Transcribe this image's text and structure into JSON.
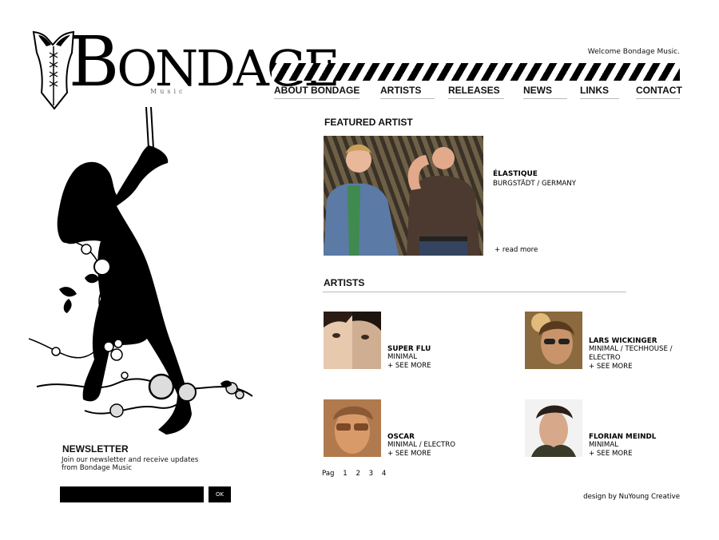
{
  "logo": {
    "text_b": "B",
    "text_rest": "ONDAGE",
    "sub": "Music"
  },
  "header": {
    "welcome": "Welcome Bondage Music."
  },
  "nav": {
    "items": [
      {
        "label": "ABOUT BONDAGE"
      },
      {
        "label": "ARTISTS"
      },
      {
        "label": "RELEASES"
      },
      {
        "label": "NEWS"
      },
      {
        "label": "LINKS"
      },
      {
        "label": "CONTACT"
      }
    ]
  },
  "featured": {
    "title": "FEATURED ARTIST",
    "name": "ÉLASTIQUE",
    "location": "BURGSTÄDT / GERMANY",
    "more": "+ read more"
  },
  "artists": {
    "title": "ARTISTS",
    "items": [
      {
        "name": "SUPER FLU",
        "genre": "MINIMAL",
        "more": "+ SEE MORE"
      },
      {
        "name": "LARS WICKINGER",
        "genre": "MINIMAL / TECHHOUSE / ELECTRO",
        "more": "+ SEE MORE"
      },
      {
        "name": "OSCAR",
        "genre": "MINIMAL / ELECTRO",
        "more": "+ SEE MORE"
      },
      {
        "name": "FLORIAN MEINDL",
        "genre": "MINIMAL",
        "more": "+ SEE MORE"
      }
    ]
  },
  "pager": {
    "label": "Pag",
    "pages": [
      "1",
      "2",
      "3",
      "4"
    ]
  },
  "newsletter": {
    "title": "NEWSLETTER",
    "text": "Join our newsletter and receive updates from Bondage Music",
    "input_value": "",
    "ok": "OK"
  },
  "footer": {
    "credit": "design by NuYoung Creative"
  }
}
